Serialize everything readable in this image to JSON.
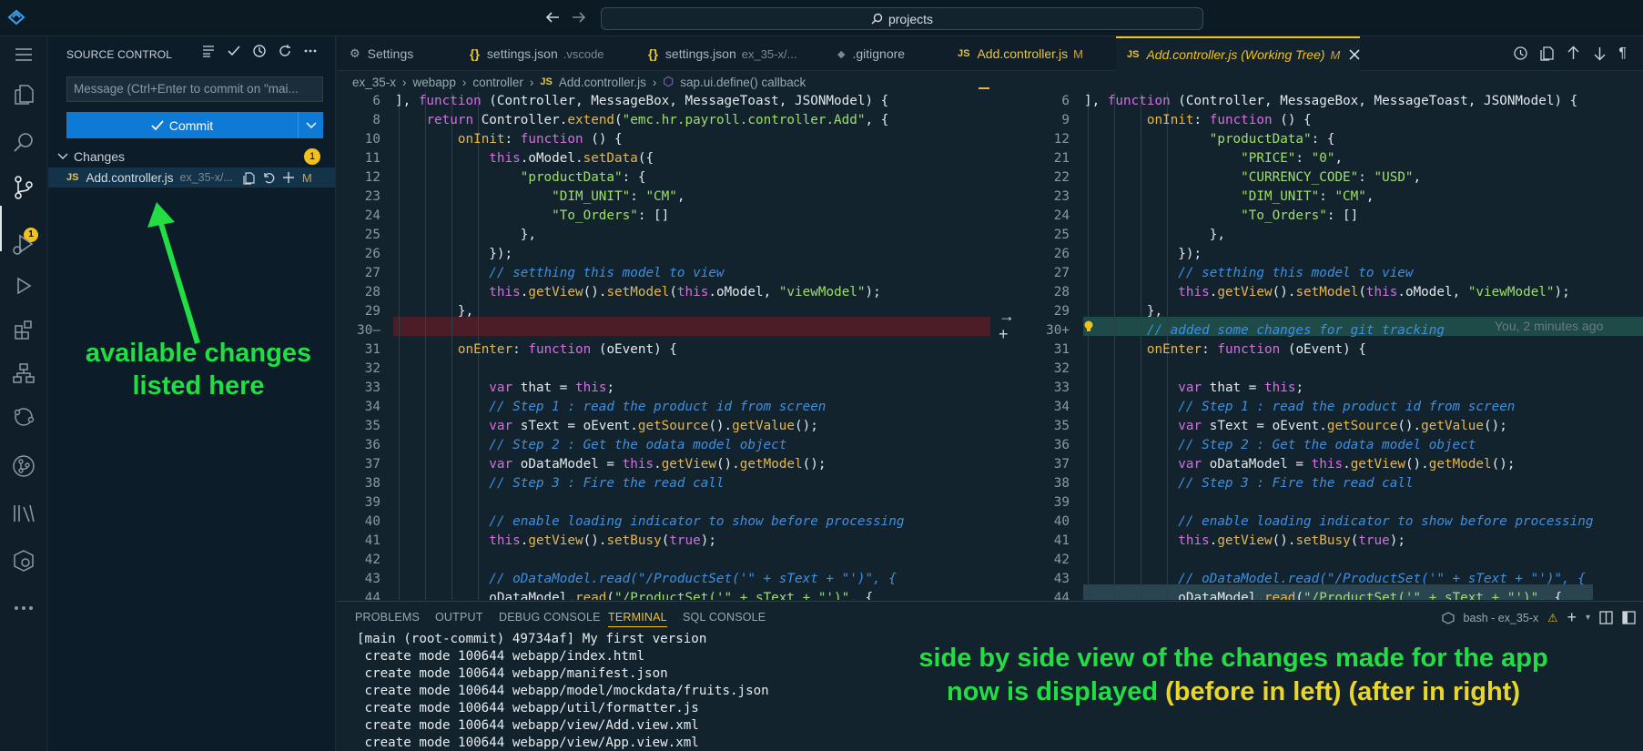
{
  "titlebar": {
    "search_text": "projects",
    "back_icon": "arrow-left-icon",
    "forward_icon": "arrow-right-icon"
  },
  "sidebar": {
    "title": "SOURCE CONTROL",
    "message_placeholder": "Message (Ctrl+Enter to commit on \"mai...",
    "commit_label": "Commit",
    "changes_label": "Changes",
    "changes_count": "1",
    "file": {
      "icon": "JS",
      "name": "Add.controller.js",
      "path": "ex_35-x/...",
      "status": "M"
    },
    "activity_badge": "1"
  },
  "annotations": {
    "left_line1": "available changes",
    "left_line2": "listed here",
    "bottom_line1": "side by side view of the changes made for the app",
    "bottom_line2a": "now is displayed ",
    "bottom_line2b": "(before in left) (after in right)"
  },
  "tabs": [
    {
      "icon": "⚙",
      "label": "Settings",
      "sub": ""
    },
    {
      "icon": "{}",
      "label": "settings.json",
      "sub": ".vscode"
    },
    {
      "icon": "{}",
      "label": "settings.json",
      "sub": "ex_35-x/..."
    },
    {
      "icon": "◆",
      "label": ".gitignore",
      "sub": ""
    },
    {
      "icon": "JS",
      "label": "Add.controller.js",
      "sub": "M"
    },
    {
      "icon": "JS",
      "label": "Add.controller.js (Working Tree)",
      "sub": "M"
    }
  ],
  "breadcrumb": [
    "ex_35-x",
    "webapp",
    "controller",
    "Add.controller.js",
    "sap.ui.define() callback"
  ],
  "diff_left": [
    {
      "n": "6",
      "segs": [
        [
          "p",
          "], "
        ],
        [
          "k",
          "function"
        ],
        [
          "p",
          " (Controller, MessageBox, MessageToast, JSONModel) {"
        ]
      ]
    },
    {
      "n": "8",
      "segs": [
        [
          "p",
          "    "
        ],
        [
          "k",
          "return"
        ],
        [
          "p",
          " Controller."
        ],
        [
          "f",
          "extend"
        ],
        [
          "p",
          "("
        ],
        [
          "s",
          "\"emc.hr.payroll.controller.Add\""
        ],
        [
          "p",
          ", {"
        ]
      ]
    },
    {
      "n": "10",
      "segs": [
        [
          "p",
          "        "
        ],
        [
          "f",
          "onInit"
        ],
        [
          "p",
          ": "
        ],
        [
          "k",
          "function"
        ],
        [
          "p",
          " () {"
        ]
      ]
    },
    {
      "n": "11",
      "segs": [
        [
          "p",
          "            "
        ],
        [
          "k",
          "this"
        ],
        [
          "p",
          ".oModel."
        ],
        [
          "f",
          "setData"
        ],
        [
          "p",
          "({"
        ]
      ]
    },
    {
      "n": "12",
      "segs": [
        [
          "p",
          "                "
        ],
        [
          "s",
          "\"productData\""
        ],
        [
          "p",
          ": {"
        ]
      ]
    },
    {
      "n": "23",
      "segs": [
        [
          "p",
          "                    "
        ],
        [
          "s",
          "\"DIM_UNIT\""
        ],
        [
          "p",
          ": "
        ],
        [
          "s",
          "\"CM\""
        ],
        [
          "p",
          ","
        ]
      ]
    },
    {
      "n": "24",
      "segs": [
        [
          "p",
          "                    "
        ],
        [
          "s",
          "\"To_Orders\""
        ],
        [
          "p",
          ": []"
        ]
      ]
    },
    {
      "n": "25",
      "segs": [
        [
          "p",
          "                },"
        ]
      ]
    },
    {
      "n": "26",
      "segs": [
        [
          "p",
          "            });"
        ]
      ]
    },
    {
      "n": "27",
      "segs": [
        [
          "c",
          "            // setthing this model to view"
        ]
      ]
    },
    {
      "n": "28",
      "segs": [
        [
          "p",
          "            "
        ],
        [
          "k",
          "this"
        ],
        [
          "p",
          "."
        ],
        [
          "f",
          "getView"
        ],
        [
          "p",
          "()."
        ],
        [
          "f",
          "setModel"
        ],
        [
          "p",
          "("
        ],
        [
          "k",
          "this"
        ],
        [
          "p",
          ".oModel, "
        ],
        [
          "s",
          "\"viewModel\""
        ],
        [
          "p",
          ");"
        ]
      ]
    },
    {
      "n": "29",
      "segs": [
        [
          "p",
          "        },"
        ]
      ]
    },
    {
      "n": "30—",
      "segs": []
    },
    {
      "n": "31",
      "segs": [
        [
          "p",
          "        "
        ],
        [
          "f",
          "onEnter"
        ],
        [
          "p",
          ": "
        ],
        [
          "k",
          "function"
        ],
        [
          "p",
          " (oEvent) {"
        ]
      ]
    },
    {
      "n": "32",
      "segs": []
    },
    {
      "n": "33",
      "segs": [
        [
          "p",
          "            "
        ],
        [
          "k",
          "var"
        ],
        [
          "p",
          " that = "
        ],
        [
          "k",
          "this"
        ],
        [
          "p",
          ";"
        ]
      ]
    },
    {
      "n": "34",
      "segs": [
        [
          "c",
          "            // Step 1 : read the product id from screen"
        ]
      ]
    },
    {
      "n": "35",
      "segs": [
        [
          "p",
          "            "
        ],
        [
          "k",
          "var"
        ],
        [
          "p",
          " sText = oEvent."
        ],
        [
          "f",
          "getSource"
        ],
        [
          "p",
          "()."
        ],
        [
          "f",
          "getValue"
        ],
        [
          "p",
          "();"
        ]
      ]
    },
    {
      "n": "36",
      "segs": [
        [
          "c",
          "            // Step 2 : Get the odata model object"
        ]
      ]
    },
    {
      "n": "37",
      "segs": [
        [
          "p",
          "            "
        ],
        [
          "k",
          "var"
        ],
        [
          "p",
          " oDataModel = "
        ],
        [
          "k",
          "this"
        ],
        [
          "p",
          "."
        ],
        [
          "f",
          "getView"
        ],
        [
          "p",
          "()."
        ],
        [
          "f",
          "getModel"
        ],
        [
          "p",
          "();"
        ]
      ]
    },
    {
      "n": "38",
      "segs": [
        [
          "c",
          "            // Step 3 : Fire the read call"
        ]
      ]
    },
    {
      "n": "39",
      "segs": []
    },
    {
      "n": "40",
      "segs": [
        [
          "c",
          "            // enable loading indicator to show before processing"
        ]
      ]
    },
    {
      "n": "41",
      "segs": [
        [
          "p",
          "            "
        ],
        [
          "k",
          "this"
        ],
        [
          "p",
          "."
        ],
        [
          "f",
          "getView"
        ],
        [
          "p",
          "()."
        ],
        [
          "f",
          "setBusy"
        ],
        [
          "p",
          "("
        ],
        [
          "k",
          "true"
        ],
        [
          "p",
          ");"
        ]
      ]
    },
    {
      "n": "42",
      "segs": []
    },
    {
      "n": "43",
      "segs": [
        [
          "c",
          "            // oDataModel.read(\"/ProductSet('\" + sText + \"')\", {"
        ]
      ]
    },
    {
      "n": "44",
      "segs": [
        [
          "p",
          "            oDataModel."
        ],
        [
          "f",
          "read"
        ],
        [
          "p",
          "("
        ],
        [
          "s",
          "\"/ProductSet('\" + sText + \"')\""
        ],
        [
          "p",
          ", {"
        ]
      ]
    }
  ],
  "diff_right": [
    {
      "n": "6",
      "segs": [
        [
          "p",
          "], "
        ],
        [
          "k",
          "function"
        ],
        [
          "p",
          " (Controller, MessageBox, MessageToast, JSONModel) {"
        ]
      ]
    },
    {
      "n": "9",
      "segs": [
        [
          "p",
          "        "
        ],
        [
          "f",
          "onInit"
        ],
        [
          "p",
          ": "
        ],
        [
          "k",
          "function"
        ],
        [
          "p",
          " () {"
        ]
      ]
    },
    {
      "n": "12",
      "segs": [
        [
          "p",
          "                "
        ],
        [
          "s",
          "\"productData\""
        ],
        [
          "p",
          ": {"
        ]
      ]
    },
    {
      "n": "21",
      "segs": [
        [
          "p",
          "                    "
        ],
        [
          "s",
          "\"PRICE\""
        ],
        [
          "p",
          ": "
        ],
        [
          "s",
          "\"0\""
        ],
        [
          "p",
          ","
        ]
      ]
    },
    {
      "n": "22",
      "segs": [
        [
          "p",
          "                    "
        ],
        [
          "s",
          "\"CURRENCY_CODE\""
        ],
        [
          "p",
          ": "
        ],
        [
          "s",
          "\"USD\""
        ],
        [
          "p",
          ","
        ]
      ]
    },
    {
      "n": "23",
      "segs": [
        [
          "p",
          "                    "
        ],
        [
          "s",
          "\"DIM_UNIT\""
        ],
        [
          "p",
          ": "
        ],
        [
          "s",
          "\"CM\""
        ],
        [
          "p",
          ","
        ]
      ]
    },
    {
      "n": "24",
      "segs": [
        [
          "p",
          "                    "
        ],
        [
          "s",
          "\"To_Orders\""
        ],
        [
          "p",
          ": []"
        ]
      ]
    },
    {
      "n": "25",
      "segs": [
        [
          "p",
          "                },"
        ]
      ]
    },
    {
      "n": "26",
      "segs": [
        [
          "p",
          "            });"
        ]
      ]
    },
    {
      "n": "27",
      "segs": [
        [
          "c",
          "            // setthing this model to view"
        ]
      ]
    },
    {
      "n": "28",
      "segs": [
        [
          "p",
          "            "
        ],
        [
          "k",
          "this"
        ],
        [
          "p",
          "."
        ],
        [
          "f",
          "getView"
        ],
        [
          "p",
          "()."
        ],
        [
          "f",
          "setModel"
        ],
        [
          "p",
          "("
        ],
        [
          "k",
          "this"
        ],
        [
          "p",
          ".oModel, "
        ],
        [
          "s",
          "\"viewModel\""
        ],
        [
          "p",
          ");"
        ]
      ]
    },
    {
      "n": "29",
      "segs": [
        [
          "p",
          "        },"
        ]
      ]
    },
    {
      "n": "30+",
      "segs": [
        [
          "c",
          "        // added some changes for git tracking"
        ]
      ]
    },
    {
      "n": "31",
      "segs": [
        [
          "p",
          "        "
        ],
        [
          "f",
          "onEnter"
        ],
        [
          "p",
          ": "
        ],
        [
          "k",
          "function"
        ],
        [
          "p",
          " (oEvent) {"
        ]
      ]
    },
    {
      "n": "32",
      "segs": []
    },
    {
      "n": "33",
      "segs": [
        [
          "p",
          "            "
        ],
        [
          "k",
          "var"
        ],
        [
          "p",
          " that = "
        ],
        [
          "k",
          "this"
        ],
        [
          "p",
          ";"
        ]
      ]
    },
    {
      "n": "34",
      "segs": [
        [
          "c",
          "            // Step 1 : read the product id from screen"
        ]
      ]
    },
    {
      "n": "35",
      "segs": [
        [
          "p",
          "            "
        ],
        [
          "k",
          "var"
        ],
        [
          "p",
          " sText = oEvent."
        ],
        [
          "f",
          "getSource"
        ],
        [
          "p",
          "()."
        ],
        [
          "f",
          "getValue"
        ],
        [
          "p",
          "();"
        ]
      ]
    },
    {
      "n": "36",
      "segs": [
        [
          "c",
          "            // Step 2 : Get the odata model object"
        ]
      ]
    },
    {
      "n": "37",
      "segs": [
        [
          "p",
          "            "
        ],
        [
          "k",
          "var"
        ],
        [
          "p",
          " oDataModel = "
        ],
        [
          "k",
          "this"
        ],
        [
          "p",
          "."
        ],
        [
          "f",
          "getView"
        ],
        [
          "p",
          "()."
        ],
        [
          "f",
          "getModel"
        ],
        [
          "p",
          "();"
        ]
      ]
    },
    {
      "n": "38",
      "segs": [
        [
          "c",
          "            // Step 3 : Fire the read call"
        ]
      ]
    },
    {
      "n": "39",
      "segs": []
    },
    {
      "n": "40",
      "segs": [
        [
          "c",
          "            // enable loading indicator to show before processing"
        ]
      ]
    },
    {
      "n": "41",
      "segs": [
        [
          "p",
          "            "
        ],
        [
          "k",
          "this"
        ],
        [
          "p",
          "."
        ],
        [
          "f",
          "getView"
        ],
        [
          "p",
          "()."
        ],
        [
          "f",
          "setBusy"
        ],
        [
          "p",
          "("
        ],
        [
          "k",
          "true"
        ],
        [
          "p",
          ");"
        ]
      ]
    },
    {
      "n": "42",
      "segs": []
    },
    {
      "n": "43",
      "segs": [
        [
          "c",
          "            // oDataModel.read(\"/ProductSet('\" + sText + \"')\", {"
        ]
      ]
    },
    {
      "n": "44",
      "segs": [
        [
          "p",
          "            oDataModel."
        ],
        [
          "f",
          "read"
        ],
        [
          "p",
          "("
        ],
        [
          "s",
          "\"/ProductSet('\" + sText + \"')\""
        ],
        [
          "p",
          ", {"
        ]
      ]
    }
  ],
  "blame": "You, 2 minutes ago",
  "panel": {
    "tabs": [
      "PROBLEMS",
      "OUTPUT",
      "DEBUG CONSOLE",
      "TERMINAL",
      "SQL CONSOLE"
    ],
    "terminal_name": "bash - ex_35-x",
    "terminal_lines": [
      "[main (root-commit) 49734af] My first version",
      " create mode 100644 webapp/index.html",
      " create mode 100644 webapp/manifest.json",
      " create mode 100644 webapp/model/mockdata/fruits.json",
      " create mode 100644 webapp/util/formatter.js",
      " create mode 100644 webapp/view/Add.view.xml",
      " create mode 100644 webapp/view/App.view.xml"
    ]
  },
  "colors": {
    "accent": "#f1c21b",
    "commit_button": "#0e7ad5",
    "annotation_green": "#22dd44",
    "annotation_yellow": "#e8d62a",
    "deleted_line": "#4a1d27",
    "added_line": "#1e4a48"
  }
}
